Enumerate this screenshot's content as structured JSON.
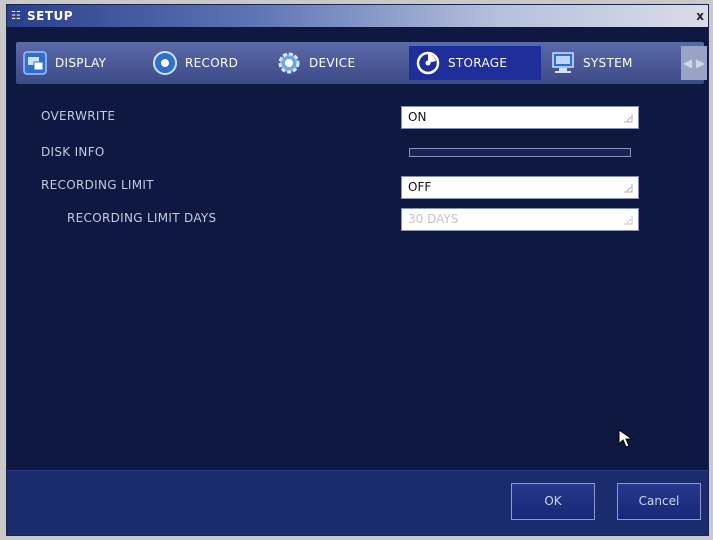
{
  "window": {
    "title": "SETUP",
    "close_glyph": "x"
  },
  "tabs": [
    {
      "label": "DISPLAY",
      "icon": "display-icon",
      "active": false
    },
    {
      "label": "RECORD",
      "icon": "record-icon",
      "active": false
    },
    {
      "label": "DEVICE",
      "icon": "device-icon",
      "active": false
    },
    {
      "label": "STORAGE",
      "icon": "storage-icon",
      "active": true
    },
    {
      "label": "SYSTEM",
      "icon": "system-icon",
      "active": false
    }
  ],
  "settings": {
    "overwrite": {
      "label": "OVERWRITE",
      "value": "ON"
    },
    "disk_info": {
      "label": "DISK INFO",
      "usage_percent": 0
    },
    "recording_limit": {
      "label": "RECORDING LIMIT",
      "value": "OFF"
    },
    "recording_limit_days": {
      "label": "RECORDING LIMIT DAYS",
      "value": "30 DAYS",
      "disabled": true
    }
  },
  "buttons": {
    "ok": "OK",
    "cancel": "Cancel"
  },
  "colors": {
    "background": "#0e1840",
    "tab_bar": "#4a5898",
    "active_tab": "#1e2f9c",
    "footer": "#1a2b6e",
    "label_text": "#c5cbe2"
  }
}
